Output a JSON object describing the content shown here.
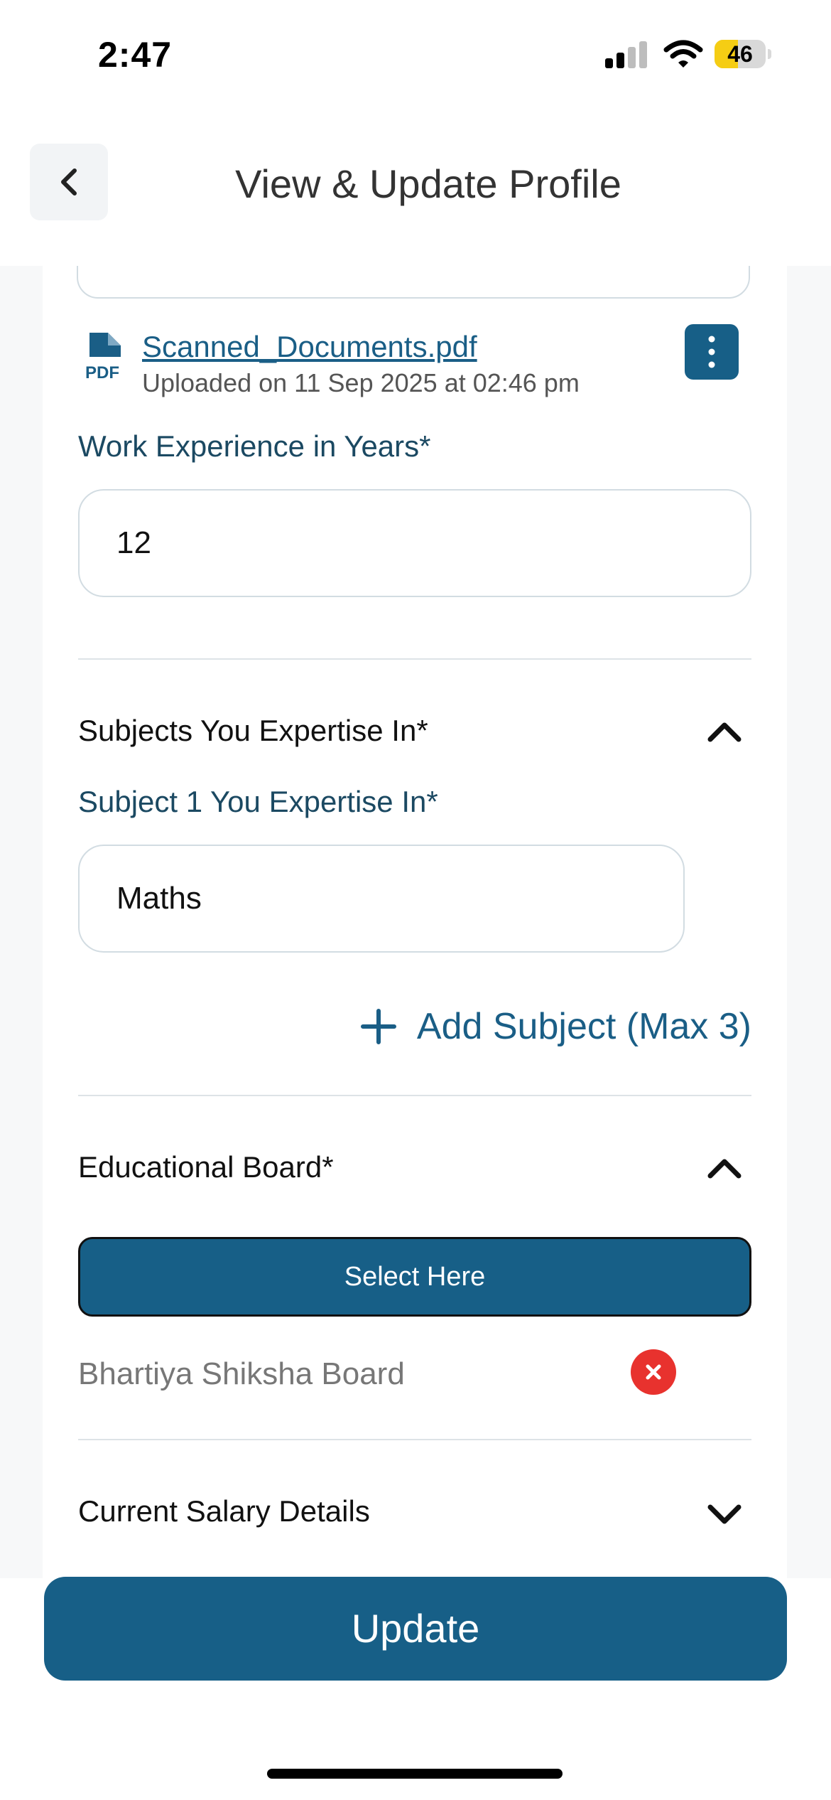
{
  "status_bar": {
    "time": "2:47",
    "battery_level": "46",
    "battery_color": "#f5cd14"
  },
  "header": {
    "title": "View & Update Profile",
    "back_icon": "chevron-left-icon"
  },
  "document": {
    "file_icon": "pdf-file-icon",
    "file_icon_label": "PDF",
    "file_name": "Scanned_Documents.pdf",
    "uploaded_text": "Uploaded on 11 Sep 2025 at 02:46 pm",
    "menu_icon": "more-vertical-icon"
  },
  "work_experience": {
    "label": "Work Experience in Years*",
    "value": "12"
  },
  "subjects": {
    "section_title": "Subjects You Expertise In*",
    "expanded": true,
    "subject1_label": "Subject 1 You Expertise In*",
    "subject1_value": "Maths",
    "add_label": "Add Subject (Max 3)"
  },
  "educational_board": {
    "section_title": "Educational Board*",
    "expanded": true,
    "select_label": "Select Here",
    "selected": [
      "Bhartiya Shiksha Board"
    ]
  },
  "salary": {
    "section_title": "Current Salary Details",
    "expanded": false
  },
  "footer": {
    "update_label": "Update"
  },
  "colors": {
    "primary": "#175f87",
    "label_text": "#1b4962",
    "danger": "#e8322e"
  }
}
